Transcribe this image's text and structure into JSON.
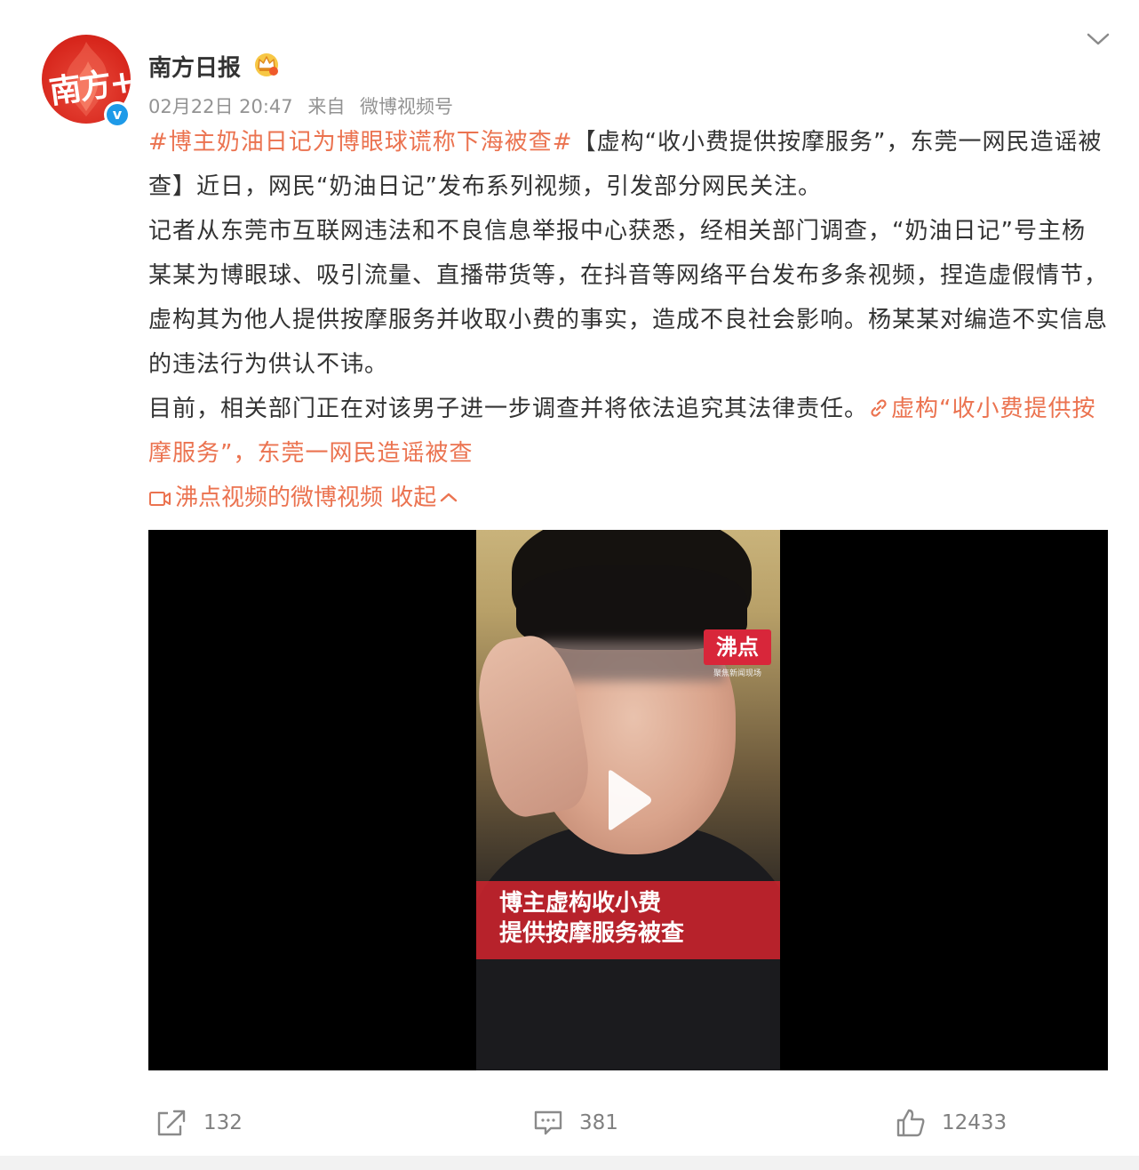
{
  "post": {
    "author": "南方日报",
    "avatar_text": "南方+",
    "verified_icon": "v",
    "date": "02月22日 20:47",
    "source_prefix": "来自",
    "source": "微博视频号",
    "hashtag": "#博主奶油日记为博眼球谎称下海被查#",
    "para1_rest": "【虚构“收小费提供按摩服务”，东莞一网民造谣被查】近日，网民“奶油日记”发布系列视频，引发部分网民关注。",
    "para2": "记者从东莞市互联网违法和不良信息举报中心获悉，经相关部门调查，“奶油日记”号主杨某某为博眼球、吸引流量、直播带货等，在抖音等网络平台发布多条视频，捏造虚假情节，虚构其为他人提供按摩服务并收取小费的事实，造成不良社会影响。杨某某对编造不实信息的违法行为供认不讳。",
    "para3": "目前，相关部门正在对该男子进一步调查并将依法追究其法律责任。",
    "article_link": "虚构“收小费提供按摩服务”，东莞一网民造谣被查",
    "video_source_link": "沸点视频的微博视频",
    "collapse_label": "收起"
  },
  "video": {
    "logo": "沸点",
    "logo_sub": "聚焦新闻现场",
    "caption_line1": "博主虚构收小费",
    "caption_line2": "提供按摩服务被查"
  },
  "actions": {
    "forward_count": "132",
    "comment_count": "381",
    "like_count": "12433"
  },
  "icons": {
    "forward": "share-icon",
    "comment": "comment-icon",
    "like": "thumbs-up-icon",
    "link": "link-icon",
    "video": "video-camera-icon",
    "play": "play-icon",
    "more": "chevron-down-icon",
    "crown": "crown-icon"
  },
  "colors": {
    "link": "#eb7350",
    "verified": "#1e9ae8",
    "meta": "#939393"
  }
}
